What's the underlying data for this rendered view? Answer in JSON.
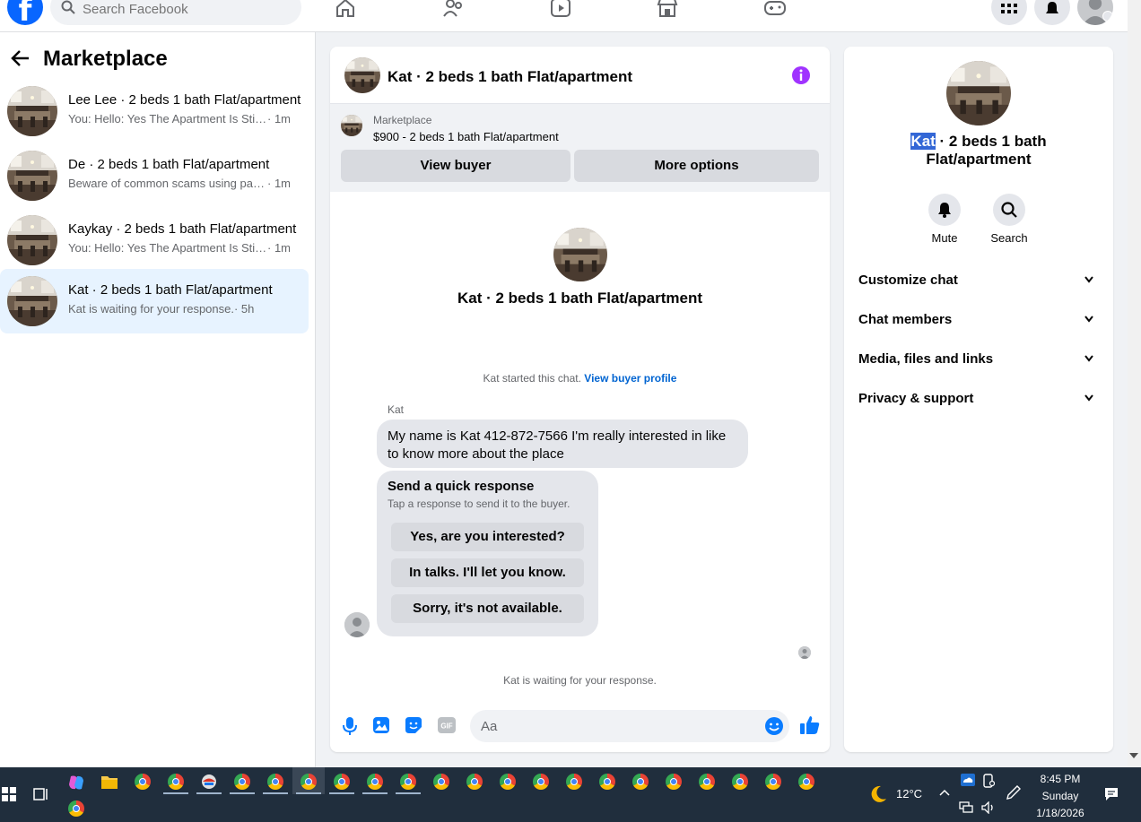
{
  "topnav": {
    "logo": "f",
    "search_placeholder": "Search Facebook"
  },
  "sidebar": {
    "title": "Marketplace",
    "conversations": [
      {
        "title": "Lee Lee · 2 beds 1 bath Flat/apartment",
        "preview": "You: Hello: Yes The Apartment Is Still Available",
        "time": " · 1m",
        "active": false
      },
      {
        "title": "De · 2 beds 1 bath Flat/apartment",
        "preview": "Beware of common scams using payment apps",
        "time": " · 1m",
        "active": false
      },
      {
        "title": "Kaykay · 2 beds 1 bath Flat/apartment",
        "preview": "You: Hello: Yes The Apartment Is Still Available",
        "time": " · 1m",
        "active": false
      },
      {
        "title": "Kat · 2 beds 1 bath Flat/apartment",
        "preview": "Kat is waiting for your response.",
        "time": " · 5h",
        "active": true
      }
    ]
  },
  "chat": {
    "title": "Kat · 2 beds 1 bath Flat/apartment",
    "listing_source": "Marketplace",
    "listing_price": "$900 - 2 beds 1 bath Flat/apartment",
    "view_buyer_label": "View buyer",
    "more_options_label": "More options",
    "intro_name": "Kat · 2 beds 1 bath Flat/apartment",
    "started_text": "Kat started this chat. ",
    "view_profile_label": "View buyer profile",
    "sender_name": "Kat",
    "message": "My name is Kat 412-872-7566 I'm really interested in like to know more about the place",
    "quick_title": "Send a quick response",
    "quick_subtitle": "Tap a response to send it to the buyer.",
    "quick_responses": [
      "Yes, are you interested?",
      "In talks. I'll let you know.",
      "Sorry, it's not available."
    ],
    "waiting_text": "Kat is waiting for your response.",
    "input_placeholder": "Aa",
    "composer_gif": "GIF"
  },
  "info_panel": {
    "name_highlight": "Kat",
    "name_rest": " · 2 beds 1 bath Flat/apartment",
    "mute_label": "Mute",
    "search_label": "Search",
    "sections": [
      "Customize chat",
      "Chat members",
      "Media, files and links",
      "Privacy & support"
    ]
  },
  "taskbar": {
    "temperature": "12°C",
    "time": "8:45 PM",
    "day": "Sunday",
    "date": "1/18/2026"
  },
  "colors": {
    "brand": "#0866ff",
    "accent_purple": "#a033ff",
    "messenger_blue": "#0a7cff",
    "active_row": "#e7f3ff"
  }
}
